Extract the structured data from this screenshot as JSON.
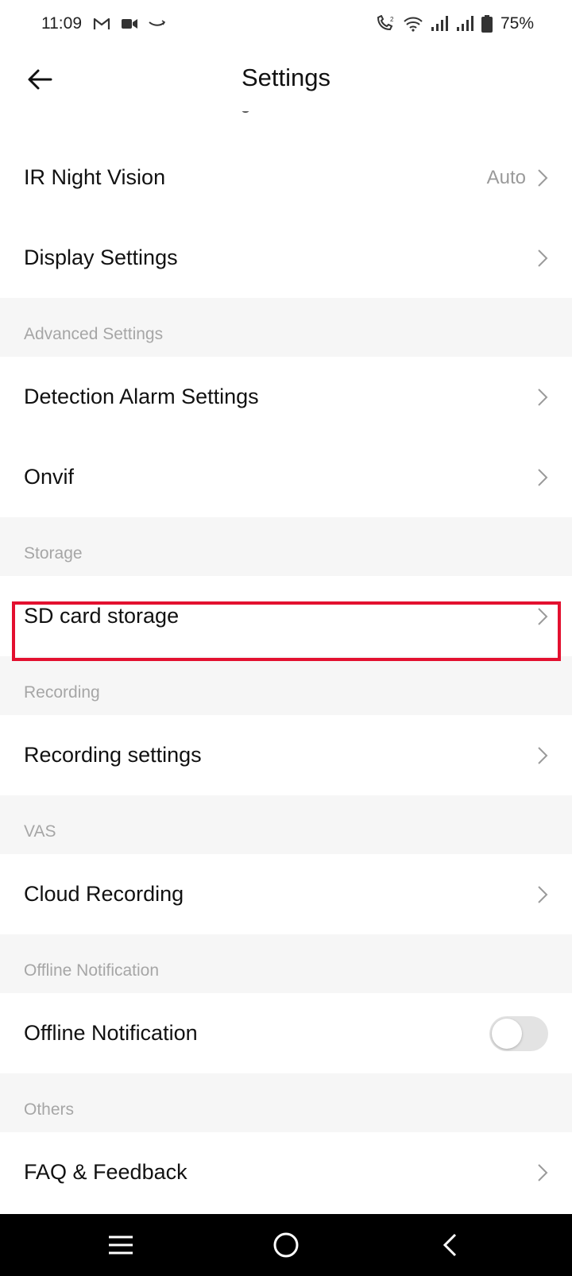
{
  "status_bar": {
    "time": "11:09",
    "battery": "75%",
    "icons": [
      "gmail-icon",
      "video-icon",
      "amazon-icon",
      "volte-call-icon",
      "wifi-icon",
      "signal-icon",
      "signal-icon",
      "battery-icon"
    ]
  },
  "header": {
    "title": "Settings",
    "back_icon": "arrow-left-icon"
  },
  "rows": {
    "ir_night_vision": {
      "label": "IR Night Vision",
      "value": "Auto"
    },
    "display_settings": {
      "label": "Display Settings"
    },
    "detection_alarm": {
      "label": "Detection Alarm Settings"
    },
    "onvif": {
      "label": "Onvif"
    },
    "sd_card": {
      "label": "SD card storage"
    },
    "recording_settings": {
      "label": "Recording settings"
    },
    "cloud_recording": {
      "label": "Cloud Recording"
    },
    "offline_notification": {
      "label": "Offline Notification",
      "enabled": false
    },
    "faq": {
      "label": "FAQ & Feedback"
    }
  },
  "sections": {
    "advanced": "Advanced Settings",
    "storage": "Storage",
    "recording": "Recording",
    "vas": "VAS",
    "offline": "Offline Notification",
    "others": "Others"
  },
  "colors": {
    "highlight": "#e3102f",
    "section_bg": "#f6f6f6",
    "section_text": "#a6a6a6"
  },
  "nav_bar": {
    "icons": [
      "recents-icon",
      "home-icon",
      "back-icon"
    ]
  }
}
